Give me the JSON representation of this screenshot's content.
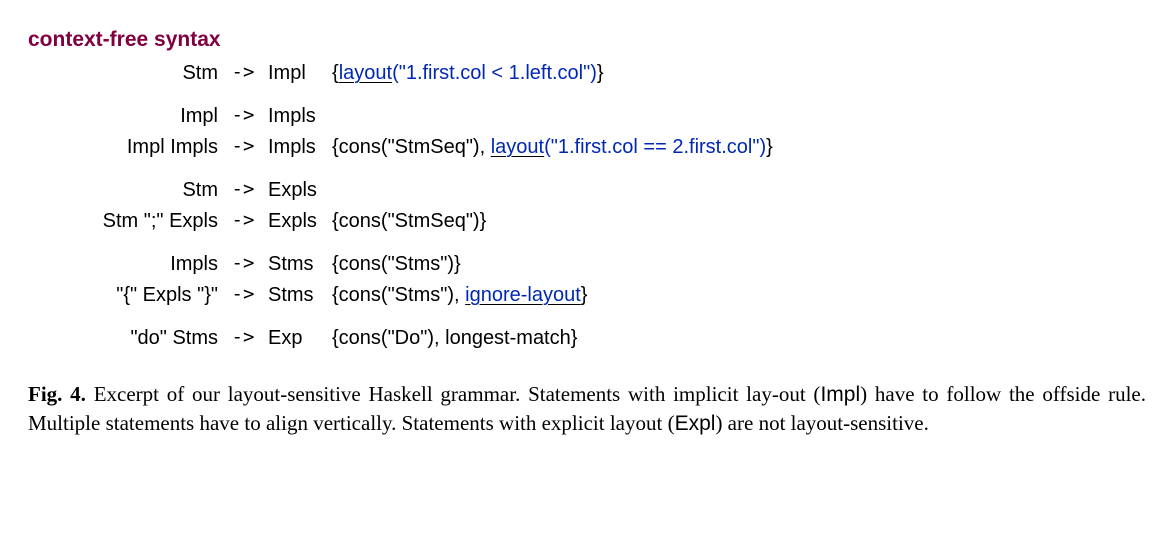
{
  "heading": "context-free syntax",
  "arrow": "->",
  "rules": {
    "g1": {
      "r1": {
        "lhs": "Stm",
        "target": "Impl",
        "annot_open": "{",
        "layout_kw": "layout",
        "layout_arg": "(\"1.first.col < 1.left.col\")",
        "annot_close": "}"
      }
    },
    "g2": {
      "r1": {
        "lhs": "Impl",
        "target": "Impls",
        "annot": ""
      },
      "r2": {
        "lhs": "Impl Impls",
        "target": "Impls",
        "annot_pre": "{cons(\"StmSeq\"), ",
        "layout_kw": "layout",
        "layout_arg": "(\"1.first.col == 2.first.col\")",
        "annot_close": "}"
      }
    },
    "g3": {
      "r1": {
        "lhs": "Stm",
        "target": "Expls",
        "annot": ""
      },
      "r2": {
        "lhs": "Stm \";\" Expls",
        "target": "Expls",
        "annot": "{cons(\"StmSeq\")}"
      }
    },
    "g4": {
      "r1": {
        "lhs": "Impls",
        "target": "Stms",
        "annot": "{cons(\"Stms\")}"
      },
      "r2": {
        "lhs": "\"{\" Expls \"}\"",
        "target": "Stms",
        "annot_pre": "{cons(\"Stms\"), ",
        "ignore_kw": "ignore-layout",
        "annot_close": "}"
      }
    },
    "g5": {
      "r1": {
        "lhs": "\"do\" Stms",
        "target": "Exp",
        "annot": "{cons(\"Do\"), longest-match}"
      }
    }
  },
  "caption": {
    "label": "Fig. 4.",
    "text_1": " Excerpt of our layout-sensitive Haskell grammar. Statements with implicit lay-out (",
    "impl": "Impl",
    "text_2": ") have to follow the offside rule. Multiple statements have to align vertically. Statements with explicit layout (",
    "expl": "Expl",
    "text_3": ") are not layout-sensitive."
  }
}
